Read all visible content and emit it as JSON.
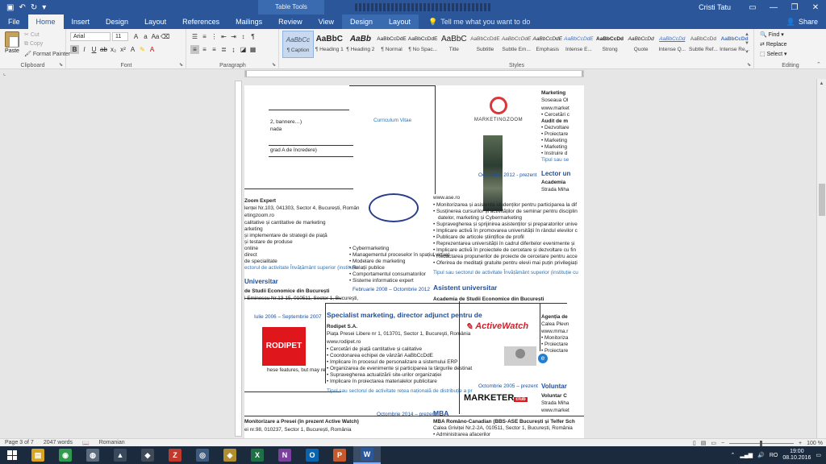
{
  "titlebar": {
    "context_tab_title": "Table Tools",
    "user_name": "Cristi Tatu",
    "qat": {
      "save_icon": "save-icon",
      "undo_icon": "undo-icon",
      "redo_icon": "redo-icon"
    }
  },
  "tabs": [
    {
      "label": "File"
    },
    {
      "label": "Home",
      "active": true
    },
    {
      "label": "Insert"
    },
    {
      "label": "Design"
    },
    {
      "label": "Layout"
    },
    {
      "label": "References"
    },
    {
      "label": "Mailings"
    },
    {
      "label": "Review"
    },
    {
      "label": "View"
    },
    {
      "label": "Design",
      "contextual": true
    },
    {
      "label": "Layout",
      "contextual": true
    }
  ],
  "tell_me": "Tell me what you want to do",
  "share_label": "Share",
  "ribbon": {
    "clipboard": {
      "paste": "Paste",
      "cut": "Cut",
      "copy": "Copy",
      "format_painter": "Format Painter",
      "group_label": "Clipboard"
    },
    "font": {
      "family": "Arial",
      "size": "11",
      "group_label": "Font"
    },
    "paragraph": {
      "group_label": "Paragraph"
    },
    "styles": {
      "group_label": "Styles",
      "items": [
        {
          "preview": "AaBbCc",
          "name": "¶ Caption"
        },
        {
          "preview": "AaBbC",
          "name": "¶ Heading 1"
        },
        {
          "preview": "AaBb",
          "name": "¶ Heading 2"
        },
        {
          "preview": "AaBbCcDdE",
          "name": "¶ Normal"
        },
        {
          "preview": "AaBbCcDdE",
          "name": "¶ No Spac..."
        },
        {
          "preview": "AaBbC",
          "name": "Title"
        },
        {
          "preview": "AaBbCcDdE",
          "name": "Subtitle"
        },
        {
          "preview": "AaBbCcDdE",
          "name": "Subtle Em..."
        },
        {
          "preview": "AaBbCcDdE",
          "name": "Emphasis"
        },
        {
          "preview": "AaBbCcDdE",
          "name": "Intense E..."
        },
        {
          "preview": "AaBbCcDd",
          "name": "Strong"
        },
        {
          "preview": "AaBbCcDd",
          "name": "Quote"
        },
        {
          "preview": "AaBbCcDd",
          "name": "Intense Q..."
        },
        {
          "preview": "AaBbCcDd",
          "name": "Subtle Ref..."
        },
        {
          "preview": "AaBbCcDd",
          "name": "Intense Re..."
        }
      ]
    },
    "editing": {
      "find": "Find",
      "replace": "Replace",
      "select": "Select",
      "group_label": "Editing"
    }
  },
  "document": {
    "lines": [
      {
        "t": "Marketing",
        "cls": "b"
      },
      {
        "t": "Soseaua Ol"
      },
      {
        "t": "www.market"
      },
      {
        "t": "• Cercetări c"
      },
      {
        "t": "Audit de m"
      },
      {
        "t": "• Dezvoltare"
      },
      {
        "t": "• Proiectare"
      },
      {
        "t": "• Marketing"
      },
      {
        "t": "• Marketing"
      },
      {
        "t": "• Instruire d"
      },
      {
        "t": "Tipul sau se"
      },
      {
        "t": "Lector un"
      },
      {
        "t": "Academia"
      },
      {
        "t": "Strada Miha"
      }
    ],
    "left_col": [
      "2, bannere…)",
      "nada",
      "grad A de încredere)",
      "Zoom Expert",
      "lenței Nr.103, 041303, Sector 4, București, Român",
      "etingzoom.ro",
      "calitative și cantitative de marketing",
      "arketing",
      "și implementare de strategii de piață",
      "și testare de produse",
      "online",
      "direct",
      "de specialitate",
      "ectorul de activitate Învățământ superior (instituție",
      "Universitar",
      "de Studii Economice din București",
      "i Eminescu Nr.13-15, 010511, Sector 1, Bucureşti,"
    ],
    "mid_col": [
      "www.ase.ro",
      "• Monitorizarea și asistenta studenților pentru participarea la dif",
      "• Susținerea cursurilor și activităților de seminar pentru disciplin",
      "datelor, marketing și Cybermarketing",
      "• Supravegherea și sprijinirea asistenților și preparatorilor unive",
      "• Implicare activă în promovarea universității în rândul elevilor c",
      "• Publicare de articole științifice de profil",
      "• Reprezentarea universității în cadrul diferitelor evenimente și",
      "• Implicare activă în proiectele de cercetare și dezvoltare cu fin",
      "• Redactarea propunerilor de proiecte de cercetare pentru acce",
      "• Oferirea de meditații gratuite pentru elevii mai puțin privilegiați",
      "Tipul sau sectorul de activitate Învățământ superior (instituție cu",
      "Asistent universitar",
      "Academia de Studii Economice din București"
    ],
    "small_list": [
      "• Cybermarketing",
      "• Managementul proceselor în spațiul virtual",
      "• Modelare de marketing",
      "• Relații publice",
      "• Comportamentul consumatorilor",
      "• Sisteme informatice expert",
      "Februarie 2008 – Octombrie 2012"
    ],
    "rodipet": [
      "Iulie 2006 – Septembrie 2007",
      "Specialist marketing, director adjunct pentru de",
      "Rodipet S.A.",
      "Piața Presei Libere nr 1, 013701, Sector 1, Bucureşti, România",
      "www.rodipet.ro",
      "• Cercetări de piață cantitative și calitative",
      "• Coordonarea echipei de vânzări AaBbCcDdE",
      "• Implicare în procesul de personalizare a sistemului ERP",
      "• Organizarea de evenimente și participarea la târgurile destinat",
      "• Supravegherea actualizării site-urilor organizației",
      "• Implicare în proiectarea materialelor publicitare",
      "Tipul sau sectorul de activitate rețea națională de distribuție a pr"
    ],
    "bottom": [
      "Monitorizare a Presei (în prezent Active Watch)",
      "ei nr.98, 010237, Sector 1, București, România",
      "Octombrie 2014 – prezent",
      "MBA",
      "MBA Româno-Canadian (BBS-ASE București și Telfer Sch",
      "Calea Griviței Nr.2-2A, 010511, Sector 1, București, România",
      "• Administrarea afacerilor",
      "Octombrie 2005 – prezent",
      "Voluntar",
      "Agenția de",
      "Calea Plevn",
      "www.mma.r",
      "• Monitoriza",
      "• Proiectare",
      "• Proiectare",
      "Voluntar C",
      "Strada Miha",
      "www.market"
    ],
    "date_mz": "Octombrie 2012 - prezent",
    "section_link": "Curriculum Vitae",
    "logo_mz": "MARKETINGZOOM",
    "logo_aw": "ActiveWatch",
    "logo_marketer": "MARKETER",
    "logo_marketer_sub": "club",
    "logo_rodipet": "RODIPET",
    "feature_note": "hese features, but may re"
  },
  "status": {
    "page": "Page 3 of 7",
    "words": "2047 words",
    "language": "Romanian",
    "zoom": "100 %"
  },
  "taskbar": {
    "apps": [
      {
        "icon": "file-explorer-icon",
        "glyph": "▤",
        "color": "#d9a521"
      },
      {
        "icon": "chrome-icon",
        "glyph": "◉",
        "color": "#2e9c4c"
      },
      {
        "icon": "app-icon-1",
        "glyph": "◍",
        "color": "#5a6b7e"
      },
      {
        "icon": "app-icon-2",
        "glyph": "▲",
        "color": "#3a4a5c"
      },
      {
        "icon": "app-icon-3",
        "glyph": "◆",
        "color": "#404a58"
      },
      {
        "icon": "filezilla-icon",
        "glyph": "Z",
        "color": "#c0392b"
      },
      {
        "icon": "app-icon-4",
        "glyph": "◎",
        "color": "#3d5a80"
      },
      {
        "icon": "app-icon-5",
        "glyph": "◈",
        "color": "#b08d2e"
      },
      {
        "icon": "excel-icon",
        "glyph": "X",
        "color": "#1e7145"
      },
      {
        "icon": "onenote-icon",
        "glyph": "N",
        "color": "#7b3f9d"
      },
      {
        "icon": "outlook-icon",
        "glyph": "O",
        "color": "#0a64ad"
      },
      {
        "icon": "powerpoint-icon",
        "glyph": "P",
        "color": "#c55a2c"
      },
      {
        "icon": "word-icon",
        "glyph": "W",
        "color": "#2b579a",
        "active": true
      }
    ],
    "lang": "RO",
    "time": "19:00",
    "date": "08.10.2016"
  },
  "colors": {
    "accent": "#2b579a",
    "taskbar": "#1c2a3e"
  }
}
